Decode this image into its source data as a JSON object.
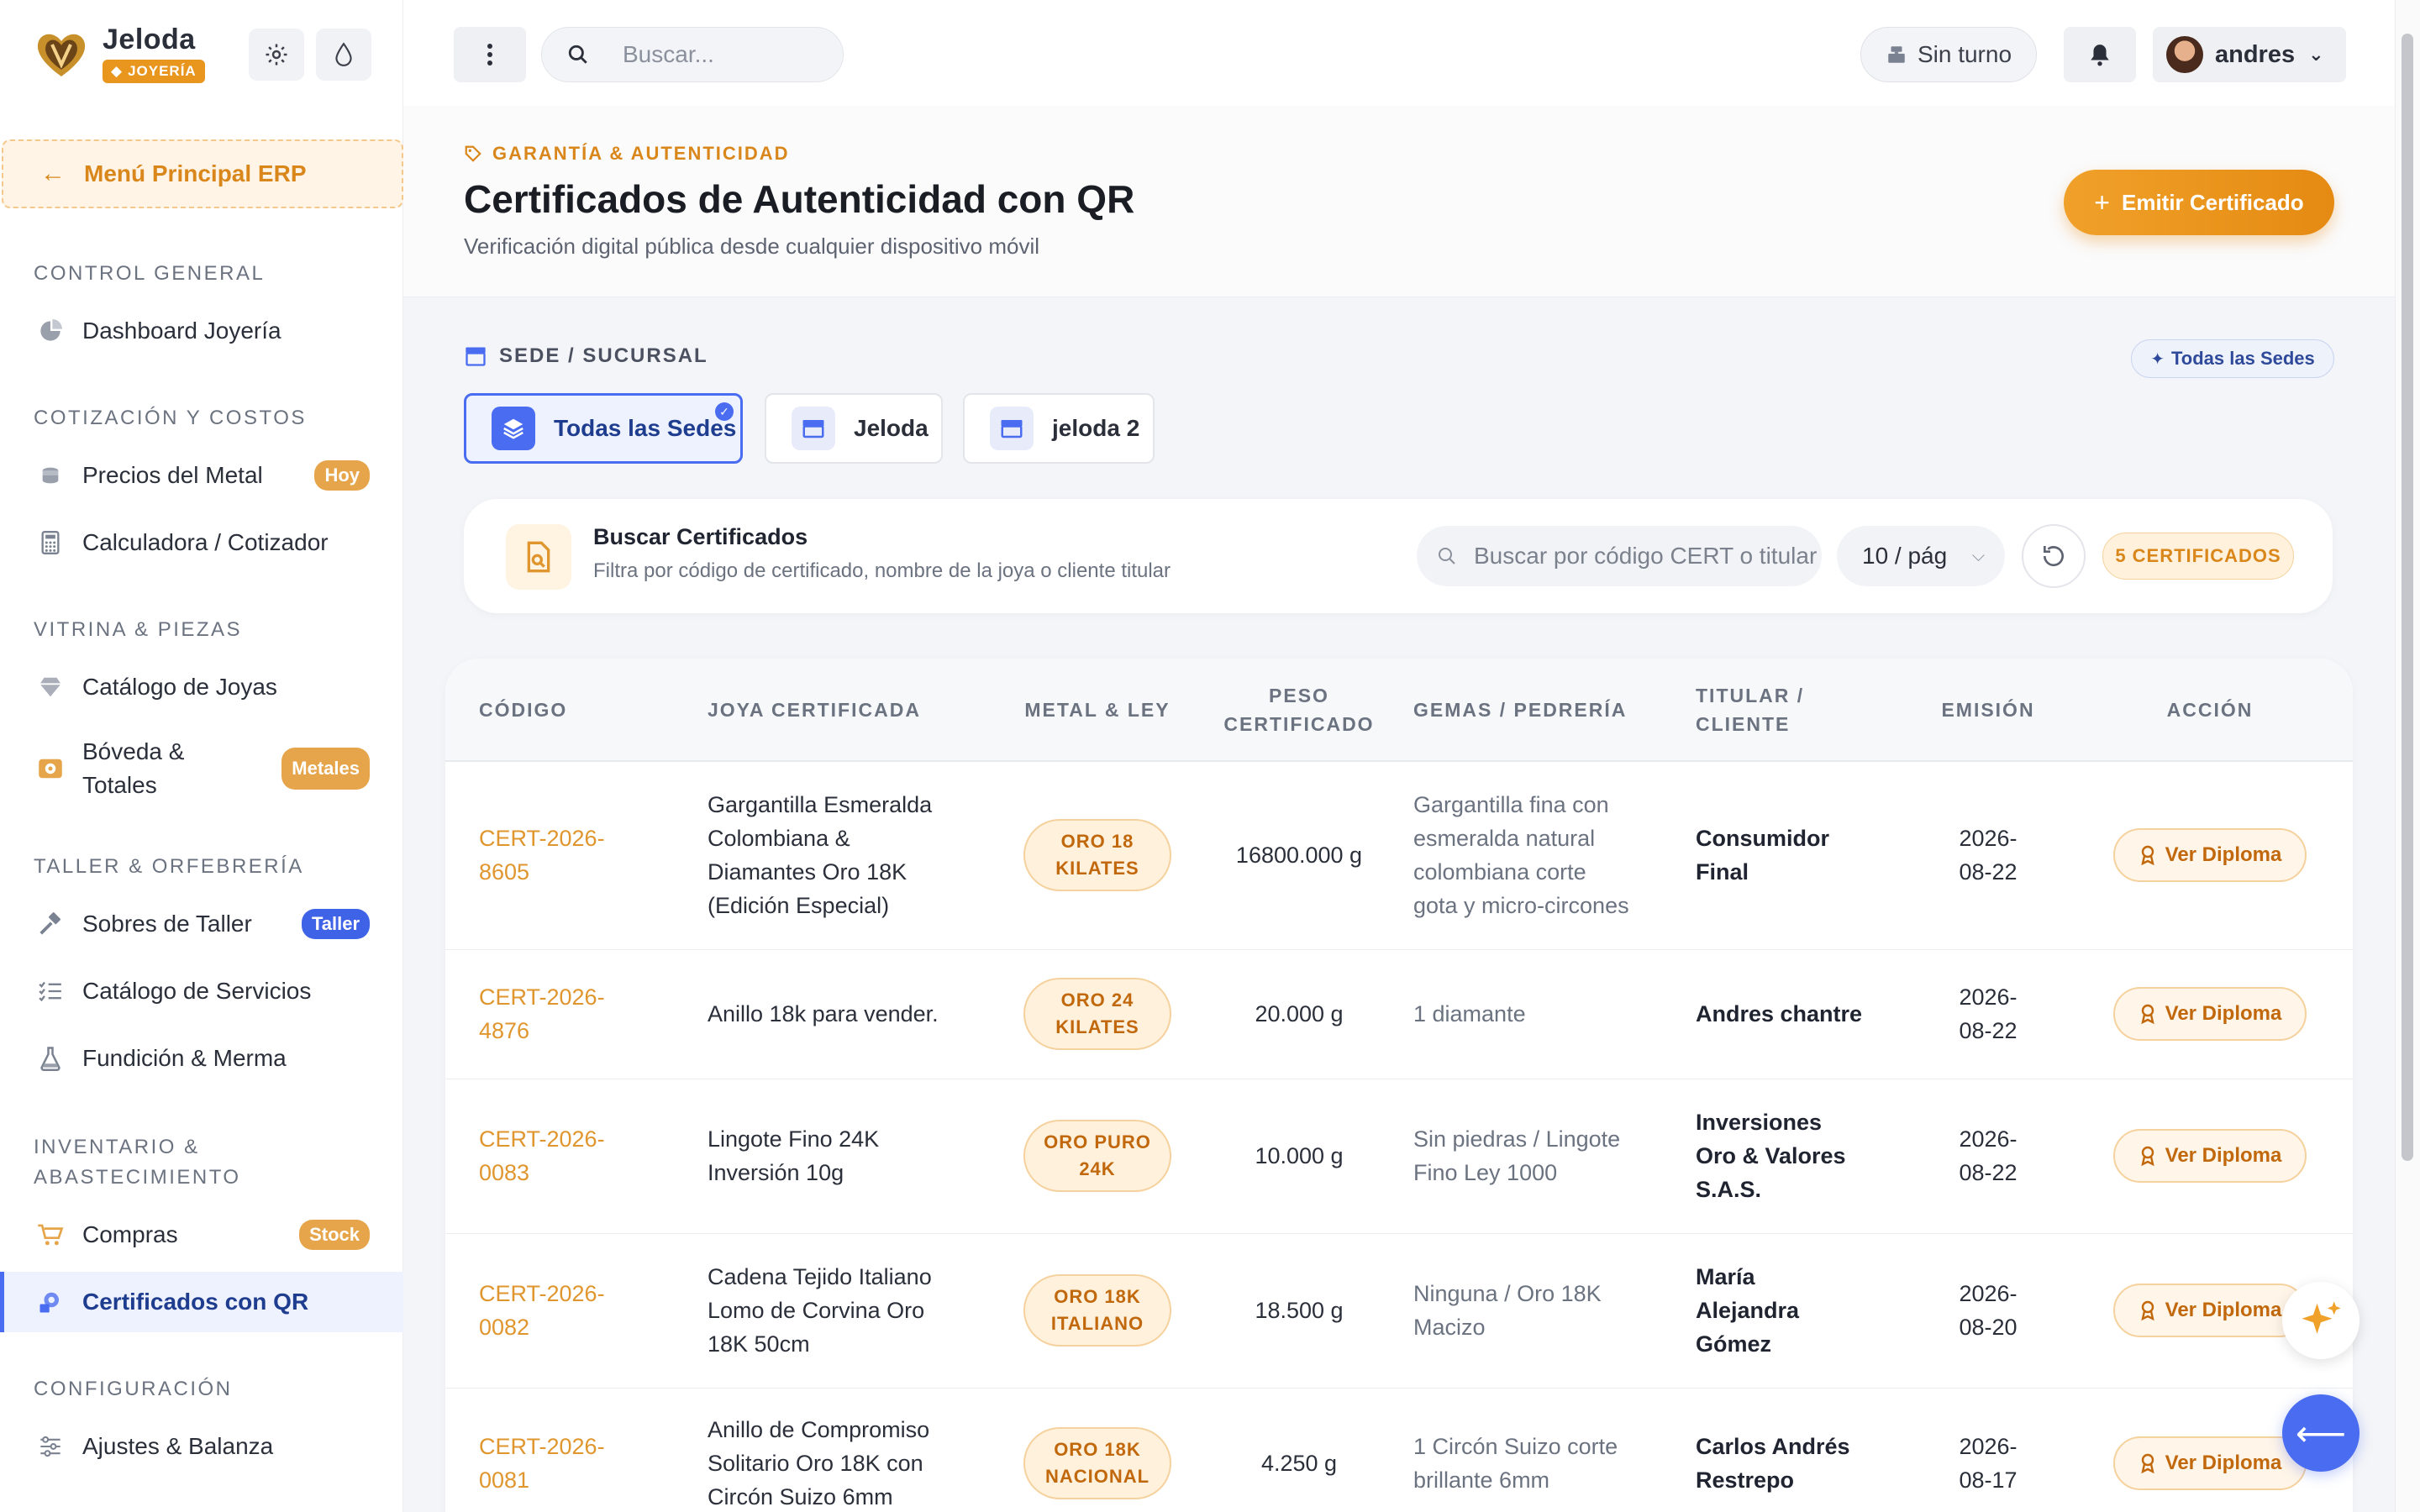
{
  "brand": {
    "name": "Jeloda",
    "badge": "JOYERÍA"
  },
  "sidebar": {
    "back_label": "Menú Principal ERP",
    "sections": [
      {
        "title": "CONTROL GENERAL"
      },
      {
        "title": "COTIZACIÓN Y COSTOS"
      },
      {
        "title": "VITRINA & PIEZAS"
      },
      {
        "title": "TALLER & ORFEBRERÍA"
      },
      {
        "title_line1": "INVENTARIO &",
        "title_line2": "ABASTECIMIENTO"
      },
      {
        "title": "CONFIGURACIÓN"
      }
    ],
    "items": [
      {
        "label": "Dashboard Joyería",
        "icon": "pie-chart-icon"
      },
      {
        "label": "Precios del Metal",
        "icon": "coins-icon",
        "tag": "Hoy"
      },
      {
        "label": "Calculadora / Cotizador",
        "icon": "calculator-icon"
      },
      {
        "label": "Catálogo de Joyas",
        "icon": "diamond-icon"
      },
      {
        "label_line1": "Bóveda &",
        "label_line2": "Totales",
        "icon": "vault-icon",
        "tag": "Metales"
      },
      {
        "label": "Sobres de Taller",
        "icon": "hammer-icon",
        "tag": "Taller"
      },
      {
        "label": "Catálogo de Servicios",
        "icon": "checklist-icon"
      },
      {
        "label": "Fundición & Merma",
        "icon": "flask-icon"
      },
      {
        "label": "Compras",
        "icon": "cart-icon",
        "tag": "Stock"
      },
      {
        "label": "Certificados con QR",
        "icon": "certificate-icon"
      },
      {
        "label": "Ajustes & Balanza",
        "icon": "sliders-icon"
      }
    ]
  },
  "topbar": {
    "search_placeholder": "Buscar...",
    "shift_label": "Sin turno",
    "user_name": "andres"
  },
  "header": {
    "eyebrow": "GARANTÍA & AUTENTICIDAD",
    "title": "Certificados de Autenticidad con QR",
    "subtitle": "Verificación digital pública desde cualquier dispositivo móvil",
    "emit_label": "Emitir Certificado"
  },
  "sede": {
    "label": "SEDE / SUCURSAL",
    "all_pill": "Todas las Sedes",
    "options": [
      {
        "label": "Todas las Sedes",
        "selected": true
      },
      {
        "label": "Jeloda",
        "selected": false
      },
      {
        "label": "jeloda 2",
        "selected": false
      }
    ]
  },
  "search_card": {
    "title": "Buscar Certificados",
    "subtitle": "Filtra por código de certificado, nombre de la joya o cliente titular",
    "input_placeholder": "Buscar por código CERT o titular",
    "page_size": "10 / pág",
    "count": "5 CERTIFICADOS"
  },
  "table": {
    "columns": {
      "code": "CÓDIGO",
      "joya": "JOYA CERTIFICADA",
      "metal": "METAL & LEY",
      "peso_1": "PESO",
      "peso_2": "CERTIFICADO",
      "gemas": "GEMAS / PEDRERÍA",
      "titular_1": "TITULAR /",
      "titular_2": "CLIENTE",
      "emision": "EMISIÓN",
      "accion": "ACCIÓN"
    },
    "action_label": "Ver Diploma",
    "rows": [
      {
        "code_1": "CERT-2026-",
        "code_2": "8605",
        "joya": [
          "Gargantilla Esmeralda",
          "Colombiana &",
          "Diamantes Oro 18K",
          "(Edición Especial)"
        ],
        "metal": [
          "ORO 18",
          "KILATES"
        ],
        "peso": "16800.000 g",
        "gemas": [
          "Gargantilla fina con",
          "esmeralda natural",
          "colombiana corte",
          "gota y micro-circones"
        ],
        "titular": [
          "Consumidor",
          "Final"
        ],
        "fecha": [
          "2026-",
          "08-22"
        ]
      },
      {
        "code_1": "CERT-2026-",
        "code_2": "4876",
        "joya": [
          "Anillo 18k para vender."
        ],
        "metal": [
          "ORO 24",
          "KILATES"
        ],
        "peso": "20.000 g",
        "gemas": [
          "1 diamante"
        ],
        "titular": [
          "Andres chantre"
        ],
        "fecha": [
          "2026-",
          "08-22"
        ]
      },
      {
        "code_1": "CERT-2026-",
        "code_2": "0083",
        "joya": [
          "Lingote Fino 24K",
          "Inversión 10g"
        ],
        "metal": [
          "ORO PURO",
          "24K"
        ],
        "peso": "10.000 g",
        "gemas": [
          "Sin piedras / Lingote",
          "Fino Ley 1000"
        ],
        "titular": [
          "Inversiones",
          "Oro & Valores",
          "S.A.S."
        ],
        "fecha": [
          "2026-",
          "08-22"
        ]
      },
      {
        "code_1": "CERT-2026-",
        "code_2": "0082",
        "joya": [
          "Cadena Tejido Italiano",
          "Lomo de Corvina Oro",
          "18K 50cm"
        ],
        "metal": [
          "ORO 18K",
          "ITALIANO"
        ],
        "peso": "18.500 g",
        "gemas": [
          "Ninguna / Oro 18K",
          "Macizo"
        ],
        "titular": [
          "María",
          "Alejandra",
          "Gómez"
        ],
        "fecha": [
          "2026-",
          "08-20"
        ]
      },
      {
        "code_1": "CERT-2026-",
        "code_2": "0081",
        "joya": [
          "Anillo de Compromiso",
          "Solitario Oro 18K con",
          "Circón Suizo 6mm"
        ],
        "metal": [
          "ORO 18K",
          "NACIONAL"
        ],
        "peso": "4.250 g",
        "gemas": [
          "1 Circón Suizo corte",
          "brillante 6mm"
        ],
        "titular": [
          "Carlos Andrés",
          "Restrepo"
        ],
        "fecha": [
          "2026-",
          "08-17"
        ]
      }
    ]
  },
  "colors": {
    "accent": "#e8961e",
    "primary": "#4a6cf0",
    "tag_blue": "#3f63e6"
  }
}
